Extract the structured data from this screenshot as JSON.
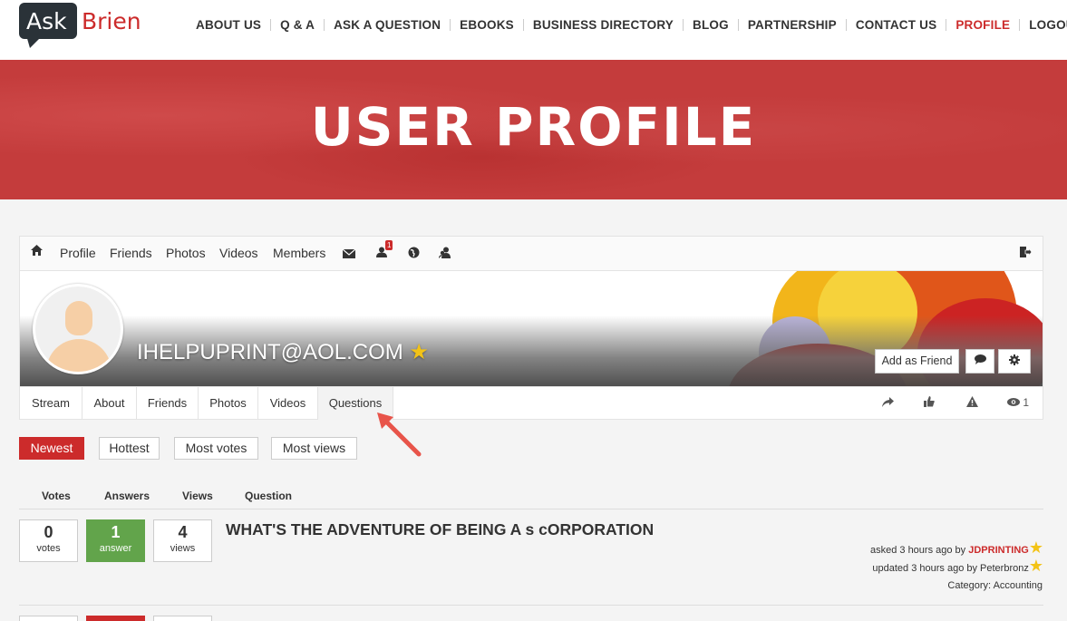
{
  "brand": {
    "ask": "Ask",
    "brien": "Brien"
  },
  "nav": [
    {
      "label": "ABOUT US",
      "active": false
    },
    {
      "label": "Q & A",
      "active": false
    },
    {
      "label": "ASK A QUESTION",
      "active": false
    },
    {
      "label": "EBOOKS",
      "active": false
    },
    {
      "label": "BUSINESS DIRECTORY",
      "active": false
    },
    {
      "label": "BLOG",
      "active": false
    },
    {
      "label": "PARTNERSHIP",
      "active": false
    },
    {
      "label": "CONTACT US",
      "active": false
    },
    {
      "label": "PROFILE",
      "active": true
    },
    {
      "label": "LOGOUT",
      "active": false
    }
  ],
  "banner": {
    "title": "USER PROFILE"
  },
  "toolbar": {
    "home_icon": "home-icon",
    "items": [
      "Profile",
      "Friends",
      "Photos",
      "Videos",
      "Members"
    ],
    "notification_count": "1",
    "icons": [
      "envelope-icon",
      "user-icon",
      "globe-icon",
      "users-icon",
      "logout-icon"
    ]
  },
  "profile": {
    "username": "IHELPUPRINT@AOL.COM",
    "star": "★",
    "add_friend": "Add as Friend",
    "views_count": "1"
  },
  "tabs": [
    "Stream",
    "About",
    "Friends",
    "Photos",
    "Videos",
    "Questions"
  ],
  "active_tab": "Questions",
  "filters": [
    {
      "label": "Newest",
      "active": true
    },
    {
      "label": "Hottest",
      "active": false
    },
    {
      "label": "Most votes",
      "active": false
    },
    {
      "label": "Most views",
      "active": false
    }
  ],
  "columns": [
    "Votes",
    "Answers",
    "Views",
    "Question"
  ],
  "questions": [
    {
      "votes": "0",
      "votes_label": "votes",
      "answers": "1",
      "answers_label": "answer",
      "views": "4",
      "views_label": "views",
      "title": "WHAT'S THE ADVENTURE OF BEING A s cORPORATION",
      "asked": "asked 3 hours ago by",
      "asked_by": "JDPRINTING",
      "updated": "updated 3 hours ago by",
      "updated_by": "Peterbronz",
      "category_label": "Category:",
      "category": "Accounting"
    }
  ],
  "colors": {
    "accent": "#cc2b2b",
    "answer_green": "#62a44b",
    "star": "#f3c316"
  }
}
